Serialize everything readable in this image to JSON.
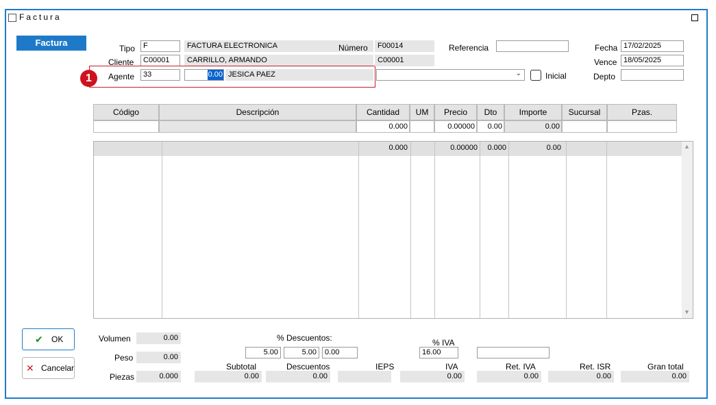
{
  "window": {
    "title": "Factura"
  },
  "section_tab": "Factura",
  "header": {
    "tipo_label": "Tipo",
    "tipo_code": "F",
    "tipo_desc": "FACTURA ELECTRONICA",
    "cliente_label": "Cliente",
    "cliente_code": "C00001",
    "cliente_name": "CARRILLO, ARMANDO",
    "agente_label": "Agente",
    "agente_code": "33",
    "agente_pct": "0.00",
    "agente_name": "JESICA PAEZ",
    "numero_label": "Número",
    "numero_value": "F00014",
    "numero_cliente": "C00001",
    "referencia_label": "Referencia",
    "referencia_value": "",
    "inicial_label": "Inicial",
    "fecha_label": "Fecha",
    "fecha_value": "17/02/2025",
    "vence_label": "Vence",
    "vence_value": "18/05/2025",
    "depto_label": "Depto",
    "depto_value": "",
    "annotation_number": "1"
  },
  "item_columns": [
    "Código",
    "Descripción",
    "Cantidad",
    "UM",
    "Precio",
    "Dto",
    "Importe",
    "Sucursal",
    "Pzas."
  ],
  "item_entry": {
    "cantidad": "0.000",
    "precio": "0.00000",
    "dto": "0.00",
    "importe": "0.00"
  },
  "lines_totals": {
    "cantidad": "0.000",
    "precio": "0.00000",
    "dto": "0.000",
    "importe": "0.00"
  },
  "buttons": {
    "ok": "OK",
    "cancel": "Cancelar"
  },
  "footer": {
    "volumen_label": "Volumen",
    "volumen": "0.00",
    "peso_label": "Peso",
    "peso": "0.00",
    "piezas_label": "Piezas",
    "piezas": "0.000",
    "descuentos_pct_label": "% Descuentos:",
    "desc1": "5.00",
    "desc2": "5.00",
    "desc3": "0.00",
    "iva_pct_label": "% IVA",
    "iva_pct": "16.00",
    "extra_value": "",
    "subtotal_label": "Subtotal",
    "subtotal": "0.00",
    "descuentos_label": "Descuentos",
    "descuentos": "0.00",
    "ieps_label": "IEPS",
    "ieps": "",
    "iva_label": "IVA",
    "iva": "0.00",
    "retiva_label": "Ret. IVA",
    "retiva": "0.00",
    "retisr_label": "Ret. ISR",
    "retisr": "0.00",
    "grantotal_label": "Gran total",
    "grantotal": "0.00"
  }
}
